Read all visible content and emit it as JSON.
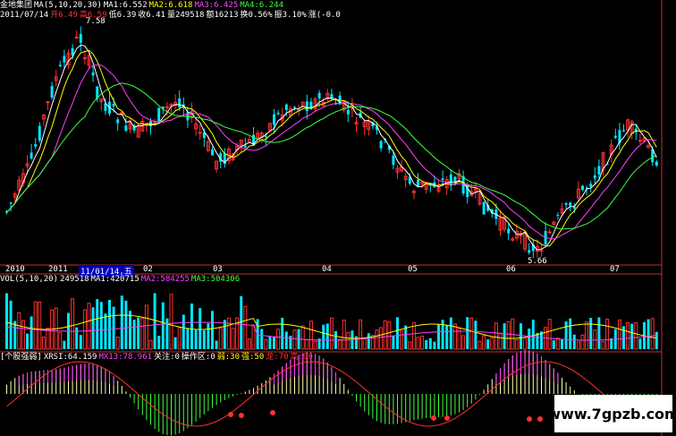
{
  "colors": {
    "up": "#ff3030",
    "down": "#00e5ff",
    "ma1": "#ffffff",
    "ma2": "#ffff00",
    "ma3": "#ff40ff",
    "ma4": "#40ff40",
    "label": "#ffff00",
    "axis": "#c03030"
  },
  "header": {
    "stock": "金地集团",
    "ma_params": "MA(5,10,20,30)",
    "ma1": "MA1:6.552",
    "ma2": "MA2:6.618",
    "ma3": "MA3:6.425",
    "ma4": "MA4:6.244",
    "date": "2011/07/14",
    "open": "开6.49",
    "high": "高6.59",
    "low": "低6.39",
    "close": "收6.41",
    "volume": "量249518",
    "amount": "额16213",
    "turnover": "换0.56%",
    "amplitude": "振3.10%",
    "change": "涨(-0.0"
  },
  "price_labels": {
    "high_label": "7.58",
    "low_label": "5.66"
  },
  "time_axis": {
    "ticks": [
      "2010",
      "2011",
      "11/01/14,五",
      "02",
      "03",
      "04",
      "05",
      "06",
      "07"
    ]
  },
  "volume_header": {
    "params": "VOL(5,10,20)",
    "vol": "249518",
    "ma1": "MA1:420715",
    "ma2": "MA2:584255",
    "ma3": "MA3:504306"
  },
  "indicator_header": {
    "name": "[个股强弱]",
    "xrsi": "XRSI:64.159",
    "mx": "MX13:78.961",
    "guanzhu": "关注:0",
    "caozuo": "操作区:0",
    "ruo": "弱:30",
    "qiang": "强:50",
    "long": "龙:70",
    "gao": "高:90"
  },
  "watermark": "www.7gpzb.com"
}
